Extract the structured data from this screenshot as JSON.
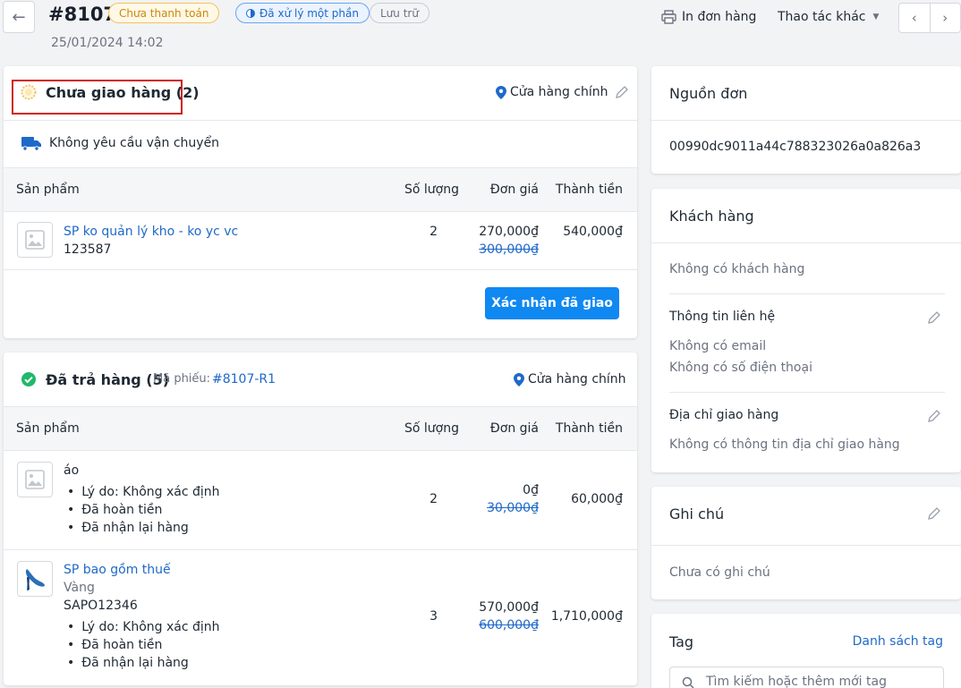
{
  "header": {
    "title": "#8107",
    "date": "25/01/2024 14:02",
    "badges": {
      "payment": "Chưa thanh toán",
      "fulfillment": "Đã xử lý một phần",
      "archive": "Lưu trữ"
    },
    "print_label": "In đơn hàng",
    "more_actions_label": "Thao tác khác"
  },
  "unfulfilled": {
    "title": "Chưa giao hàng (2)",
    "location": "Cửa hàng chính",
    "shipping_note": "Không yêu cầu vận chuyển",
    "columns": [
      "Sản phẩm",
      "Số lượng",
      "Đơn giá",
      "Thành tiền"
    ],
    "item": {
      "name": "SP ko quản lý kho - ko yc vc",
      "sku": "123587",
      "qty": "2",
      "price": "270,000₫",
      "original_price": "300,000₫",
      "total": "540,000₫"
    },
    "confirm_label": "Xác nhận đã giao"
  },
  "returned": {
    "title": "Đã trả hàng (5)",
    "ticket_label": "Mã phiếu:",
    "ticket_code": "#8107-R1",
    "location": "Cửa hàng chính",
    "columns": [
      "Sản phẩm",
      "Số lượng",
      "Đơn giá",
      "Thành tiền"
    ],
    "items": [
      {
        "name": "áo",
        "notes": [
          "Lý do: Không xác định",
          "Đã hoàn tiền",
          "Đã nhận lại hàng"
        ],
        "qty": "2",
        "price": "0₫",
        "original_price": "30,000₫",
        "total": "60,000₫"
      },
      {
        "name": "SP bao gồm thuế",
        "variant": "Vàng",
        "sku": "SAPO12346",
        "notes": [
          "Lý do: Không xác định",
          "Đã hoàn tiền",
          "Đã nhận lại hàng"
        ],
        "qty": "3",
        "price": "570,000₫",
        "original_price": "600,000₫",
        "total": "1,710,000₫"
      }
    ]
  },
  "source": {
    "title": "Nguồn đơn",
    "value": "00990dc9011a44c788323026a0a826a3"
  },
  "customer": {
    "title": "Khách hàng",
    "empty": "Không có khách hàng",
    "contact_title": "Thông tin liên hệ",
    "no_email": "Không có email",
    "no_phone": "Không có số điện thoại",
    "address_title": "Địa chỉ giao hàng",
    "no_address": "Không có thông tin địa chỉ giao hàng"
  },
  "notes": {
    "title": "Ghi chú",
    "empty": "Chưa có ghi chú"
  },
  "tags": {
    "title": "Tag",
    "list_link": "Danh sách tag",
    "search_placeholder": "Tìm kiếm hoặc thêm mới tag"
  },
  "colors": {
    "primary": "#0f88f2",
    "link": "#1f69c9",
    "pending": "#f2c35b",
    "success": "#1fb86a",
    "highlight": "#d11b1b"
  }
}
